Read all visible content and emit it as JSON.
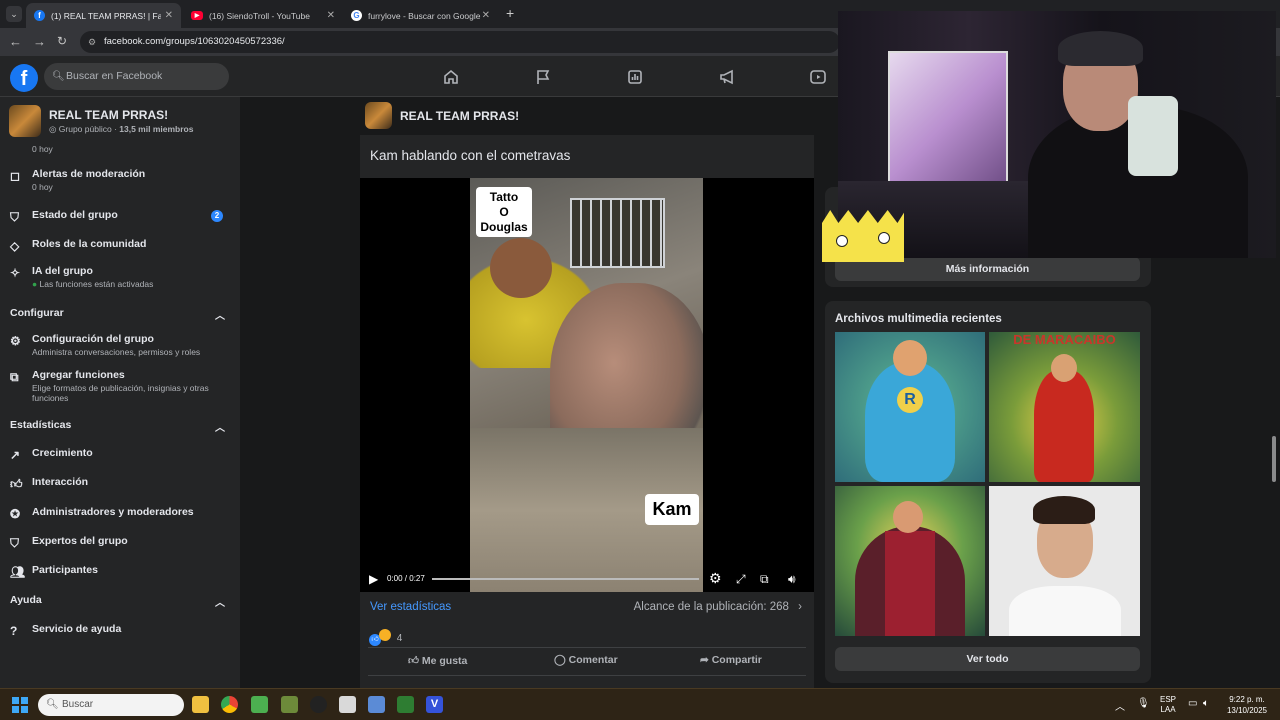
{
  "browser": {
    "tabs": [
      {
        "title": "(1) REAL TEAM PRRAS! | Facebo",
        "favicon": "facebook-icon",
        "active": true
      },
      {
        "title": "(16) SiendoTroll - YouTube",
        "favicon": "youtube-icon",
        "active": false
      },
      {
        "title": "furrylove - Buscar con Google",
        "favicon": "google-icon",
        "active": false
      }
    ],
    "new_tab": "+",
    "url": "facebook.com/groups/1063020450572336/"
  },
  "header": {
    "logo": "f",
    "search_placeholder": "Buscar en Facebook"
  },
  "sidebar": {
    "group_name": "REAL TEAM PRRAS!",
    "group_meta_prefix": "Grupo público · ",
    "group_members": "13,5 mil miembros",
    "partial_top": "0 hoy",
    "items": [
      {
        "label": "Alertas de moderación",
        "sub": "0 hoy",
        "icon": "alert-icon"
      },
      {
        "label": "Estado del grupo",
        "badge": "2",
        "icon": "shield-icon"
      },
      {
        "label": "Roles de la comunidad",
        "icon": "diamond-icon"
      },
      {
        "label": "IA del grupo",
        "sub": "Las funciones están activadas",
        "icon": "sparkle-icon"
      }
    ],
    "section_config": "Configurar",
    "config_items": [
      {
        "label": "Configuración del grupo",
        "sub": "Administra conversaciones, permisos y roles",
        "icon": "gear-icon"
      },
      {
        "label": "Agregar funciones",
        "sub": "Elige formatos de publicación, insignias y otras funciones",
        "icon": "puzzle-icon"
      }
    ],
    "section_stats": "Estadísticas",
    "stats_items": [
      {
        "label": "Crecimiento",
        "icon": "trend-icon"
      },
      {
        "label": "Interacción",
        "icon": "thumbs-up-icon"
      },
      {
        "label": "Administradores y moderadores",
        "icon": "star-icon"
      },
      {
        "label": "Expertos del grupo",
        "icon": "expert-icon"
      },
      {
        "label": "Participantes",
        "icon": "people-icon"
      }
    ],
    "section_help": "Ayuda",
    "help_items": [
      {
        "label": "Servicio de ayuda",
        "icon": "help-icon"
      }
    ]
  },
  "feed": {
    "group_name": "REAL TEAM PRRAS!",
    "post_title": "Kam hablando con el cometravas",
    "video_labels": [
      "Tatto",
      "O",
      "Douglas"
    ],
    "video_label_kam": "Kam",
    "video_time": "0:00 / 0:27",
    "stats_link": "Ver estadísticas",
    "reach": "Alcance de la publicación: 268",
    "reaction_count": "4",
    "actions": {
      "like": "Me gusta",
      "comment": "Comentar",
      "share": "Compartir"
    }
  },
  "rightcol": {
    "more_info": "Más información",
    "media_title": "Archivos multimedia recientes",
    "media_caption": "DE MARACAIBO",
    "see_all": "Ver todo"
  },
  "taskbar": {
    "search_placeholder": "Buscar",
    "lang_top": "ESP",
    "lang_bottom": "LAA",
    "time": "9:22 p. m.",
    "date": "13/10/2025"
  }
}
